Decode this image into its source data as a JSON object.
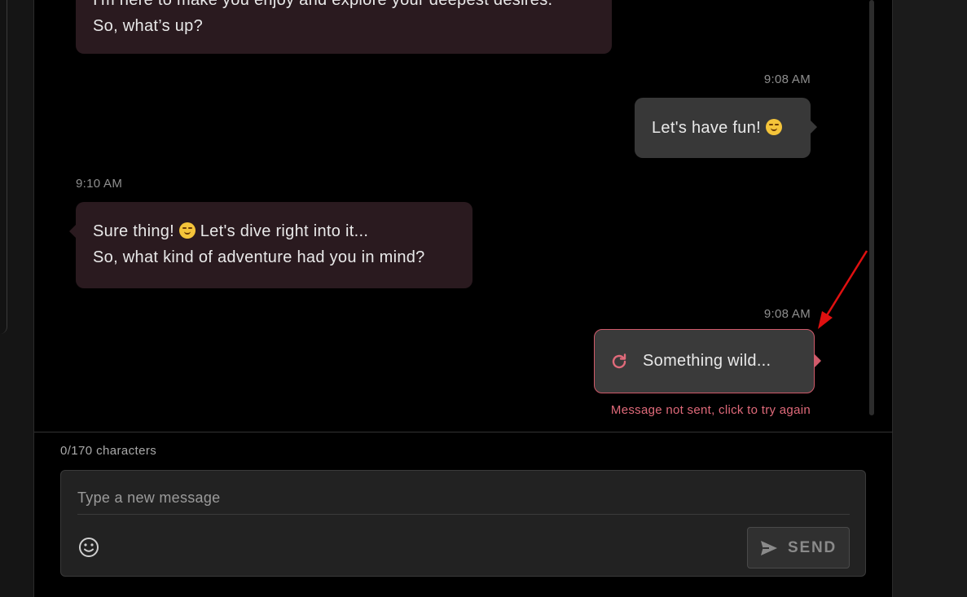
{
  "messages": [
    {
      "sender": "bot",
      "lines": [
        "I'm here to make you enjoy and explore your deepest desires.",
        "So, what’s up?"
      ]
    },
    {
      "sender": "user",
      "time": "9:08 AM",
      "text": "Let's have fun!",
      "emoji": "smirking-face-emoji"
    },
    {
      "sender": "bot",
      "time": "9:10 AM",
      "line1": "Sure thing!",
      "line1_rest": "Let's dive right into it...",
      "line2": "So, what kind of adventure had you in mind?",
      "emoji": "smiling-face-emoji"
    },
    {
      "sender": "user",
      "time": "9:08 AM",
      "text": "Something wild...",
      "status": "failed",
      "error": "Message not sent, click to try again"
    }
  ],
  "composer": {
    "char_count": "0/170 characters",
    "placeholder": "Type a new message",
    "send_label": "SEND"
  },
  "colors": {
    "bot_bubble": "#2a1a1f",
    "user_bubble": "#383838",
    "error": "#e06a7a",
    "annotation_arrow": "#e01010"
  },
  "icons": [
    "retry-icon",
    "emoji-picker-icon",
    "send-icon",
    "annotation-arrow"
  ]
}
